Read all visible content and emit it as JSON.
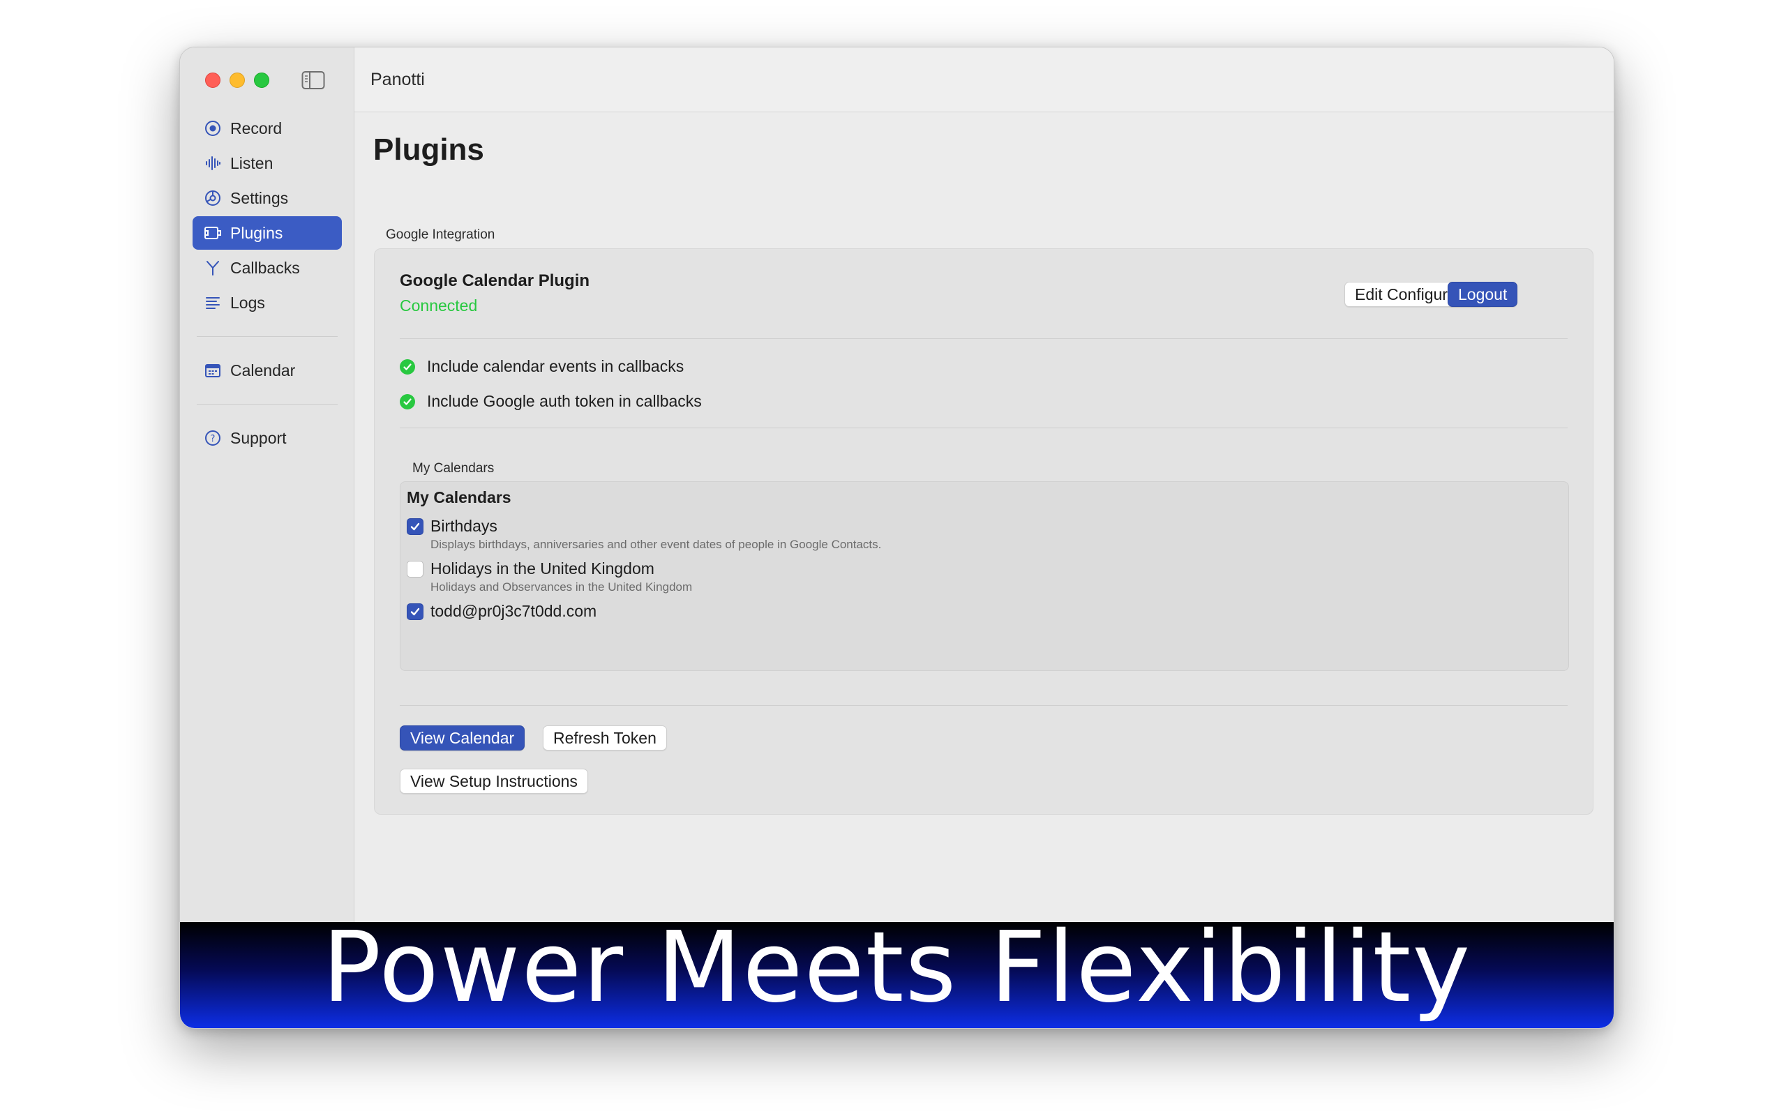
{
  "window": {
    "title": "Panotti"
  },
  "sidebar": {
    "items": [
      {
        "label": "Record",
        "icon": "record-icon"
      },
      {
        "label": "Listen",
        "icon": "waveform-icon"
      },
      {
        "label": "Settings",
        "icon": "gear-icon"
      },
      {
        "label": "Plugins",
        "icon": "plugin-icon",
        "active": true
      },
      {
        "label": "Callbacks",
        "icon": "branch-icon"
      },
      {
        "label": "Logs",
        "icon": "list-icon"
      }
    ],
    "calendar_label": "Calendar",
    "support_label": "Support"
  },
  "page": {
    "title": "Plugins",
    "group_label": "Google Integration"
  },
  "plugin": {
    "name": "Google Calendar Plugin",
    "status": "Connected",
    "edit_config_label": "Edit Configuration",
    "logout_label": "Logout",
    "options": [
      "Include calendar events in callbacks",
      "Include Google auth token in callbacks"
    ],
    "calendars_group_label": "My Calendars",
    "calendars_title": "My Calendars",
    "calendars": [
      {
        "name": "Birthdays",
        "description": "Displays birthdays, anniversaries and other event dates of people in Google Contacts.",
        "checked": true
      },
      {
        "name": "Holidays in the United Kingdom",
        "description": "Holidays and Observances in the United Kingdom",
        "checked": false
      },
      {
        "name": "todd@pr0j3c7t0dd.com",
        "description": "",
        "checked": true
      }
    ],
    "view_calendar_label": "View Calendar",
    "refresh_token_label": "Refresh Token",
    "setup_instructions_label": "View Setup Instructions"
  },
  "banner": {
    "text": "Power Meets Flexibility"
  },
  "colors": {
    "accent": "#3554b8",
    "connected": "#28c840",
    "banner_bottom": "#0d2ee6"
  }
}
